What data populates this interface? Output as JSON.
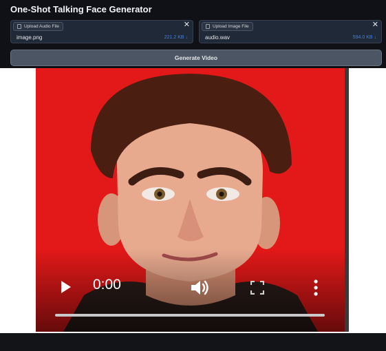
{
  "app": {
    "title": "One-Shot Talking Face Generator"
  },
  "audio_upload": {
    "label": "Upload Audio File",
    "file_name": "image.png",
    "file_size": "221.2 KB ↓",
    "close": "✕"
  },
  "image_upload": {
    "label": "Upload Image File",
    "file_name": "audio.wav",
    "file_size": "594.0 KB ↓",
    "close": "✕"
  },
  "generate": {
    "label": "Generate Video"
  },
  "video": {
    "current_time": "0:00",
    "progress": 0,
    "background_color": "#e31818"
  }
}
